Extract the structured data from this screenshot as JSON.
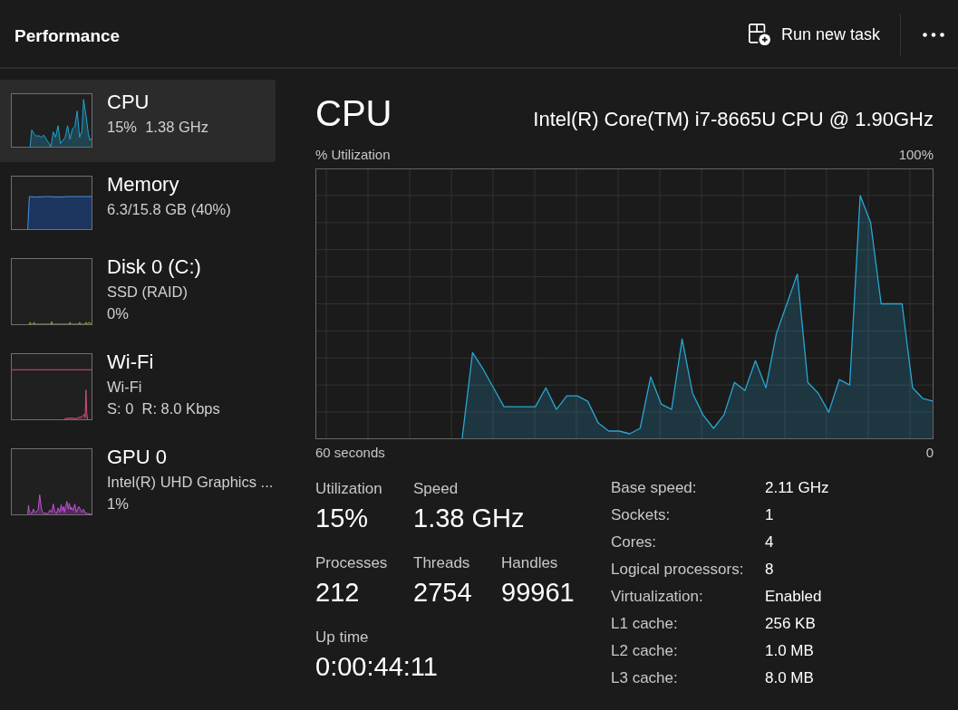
{
  "header": {
    "title": "Performance",
    "run_task_button": "Run new task"
  },
  "sidebar": {
    "items": [
      {
        "kind": "cpu",
        "name": "CPU",
        "details": [
          "15%  1.38 GHz"
        ],
        "selected": true
      },
      {
        "kind": "memory",
        "name": "Memory",
        "details": [
          "6.3/15.8 GB (40%)"
        ],
        "selected": false
      },
      {
        "kind": "disk",
        "name": "Disk 0 (C:)",
        "details": [
          "SSD (RAID)",
          "0%"
        ],
        "selected": false
      },
      {
        "kind": "network",
        "name": "Wi-Fi",
        "details": [
          "Wi-Fi",
          "S: 0  R: 8.0 Kbps"
        ],
        "selected": false
      },
      {
        "kind": "gpu",
        "name": "GPU 0",
        "details": [
          "Intel(R) UHD Graphics ...",
          "1%"
        ],
        "selected": false
      }
    ]
  },
  "detail": {
    "title": "CPU",
    "model": "Intel(R) Core(TM) i7-8665U CPU @ 1.90GHz",
    "graph": {
      "title": "% Utilization",
      "scale_max": "100%",
      "time_span": "60 seconds",
      "time_end": "0"
    },
    "stats": [
      [
        {
          "label": "Utilization",
          "value": "15%"
        },
        {
          "label": "Speed",
          "value": "1.38 GHz"
        }
      ],
      [
        {
          "label": "Processes",
          "value": "212"
        },
        {
          "label": "Threads",
          "value": "2754"
        },
        {
          "label": "Handles",
          "value": "99961"
        }
      ],
      [
        {
          "label": "Up time",
          "value": "0:00:44:11"
        }
      ]
    ],
    "specs": [
      {
        "label": "Base speed:",
        "value": "2.11 GHz"
      },
      {
        "label": "Sockets:",
        "value": "1"
      },
      {
        "label": "Cores:",
        "value": "4"
      },
      {
        "label": "Logical processors:",
        "value": "8"
      },
      {
        "label": "Virtualization:",
        "value": "Enabled"
      },
      {
        "label": "L1 cache:",
        "value": "256 KB"
      },
      {
        "label": "L2 cache:",
        "value": "1.0 MB"
      },
      {
        "label": "L3 cache:",
        "value": "8.0 MB"
      }
    ]
  }
}
